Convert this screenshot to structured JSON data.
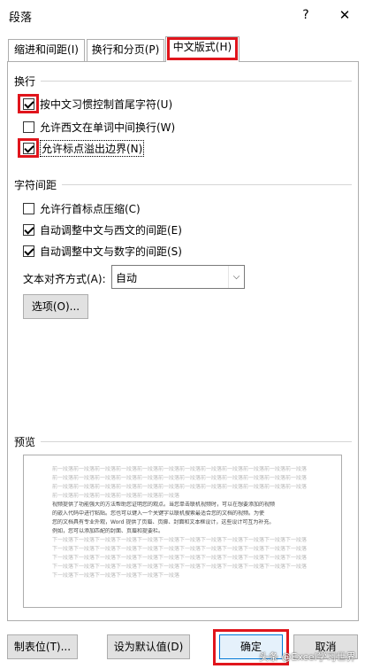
{
  "window": {
    "title": "段落",
    "help": "?",
    "close": "✕"
  },
  "tabs": [
    {
      "label": "缩进和间距(I)"
    },
    {
      "label": "换行和分页(P)"
    },
    {
      "label": "中文版式(H)"
    }
  ],
  "line_breaking": {
    "title": "换行",
    "items": [
      {
        "label": "按中文习惯控制首尾字符(U)",
        "checked": true
      },
      {
        "label": "允许西文在单词中间换行(W)",
        "checked": false
      },
      {
        "label": "允许标点溢出边界(N)",
        "checked": true
      }
    ]
  },
  "spacing": {
    "title": "字符间距",
    "items": [
      {
        "label": "允许行首标点压缩(C)",
        "checked": false
      },
      {
        "label": "自动调整中文与西文的间距(E)",
        "checked": true
      },
      {
        "label": "自动调整中文与数字的间距(S)",
        "checked": true
      }
    ],
    "align_label": "文本对齐方式(A):",
    "align_value": "自动",
    "options_button": "选项(O)..."
  },
  "preview": {
    "title": "预览",
    "lines": [
      {
        "text": "前一段落前一段落前一段落前一段落前一段落前一段落前一段落前一段落前一段落前一段落前一段落前一段落",
        "dark": false
      },
      {
        "text": "前一段落前一段落前一段落前一段落前一段落前一段落前一段落前一段落前一段落前一段落前一段落前一段落",
        "dark": false
      },
      {
        "text": "前一段落前一段落前一段落前一段落前一段落前一段落前一段落前一段落前一段落前一段落前一段落前一段落",
        "dark": false
      },
      {
        "text": "前一段落前一段落前一段落前一段落前一段落前一段落",
        "dark": false
      },
      {
        "text": "视频提供了功能强大的方法帮助您证明您的观点。当您单击联机视频时，可以在想要添加的视频",
        "dark": true
      },
      {
        "text": "的嵌入代码中进行粘贴。您也可以键入一个关键字以联机搜索最适合您的文档的视频。为使",
        "dark": true
      },
      {
        "text": "您的文档具有专业外观，Word 提供了页眉、页脚、封面和文本框设计，这些设计可互为补充。",
        "dark": true
      },
      {
        "text": "例如，您可以添加匹配的封面、页眉和提要栏。",
        "dark": true
      },
      {
        "text": "下一段落下一段落下一段落下一段落下一段落下一段落下一段落下一段落下一段落下一段落下一段落下一段落",
        "dark": false
      },
      {
        "text": "下一段落下一段落下一段落下一段落下一段落下一段落下一段落下一段落下一段落下一段落下一段落下一段落",
        "dark": false
      },
      {
        "text": "下一段落下一段落下一段落下一段落下一段落下一段落下一段落下一段落下一段落下一段落下一段落下一段落",
        "dark": false
      },
      {
        "text": "下一段落下一段落下一段落下一段落下一段落下一段落下一段落下一段落下一段落下一段落下一段落下一段落",
        "dark": false
      },
      {
        "text": "下一段落下一段落下一段落下一段落下一段落下一段落",
        "dark": false
      }
    ]
  },
  "buttons": {
    "tab_stops": "制表位(T)...",
    "set_default": "设为默认值(D)",
    "ok": "确定",
    "cancel": "取消"
  },
  "watermark": "头条 @Excel学习世界",
  "colors": {
    "highlight": "#e0151c",
    "default_button_border": "#0078d7"
  }
}
